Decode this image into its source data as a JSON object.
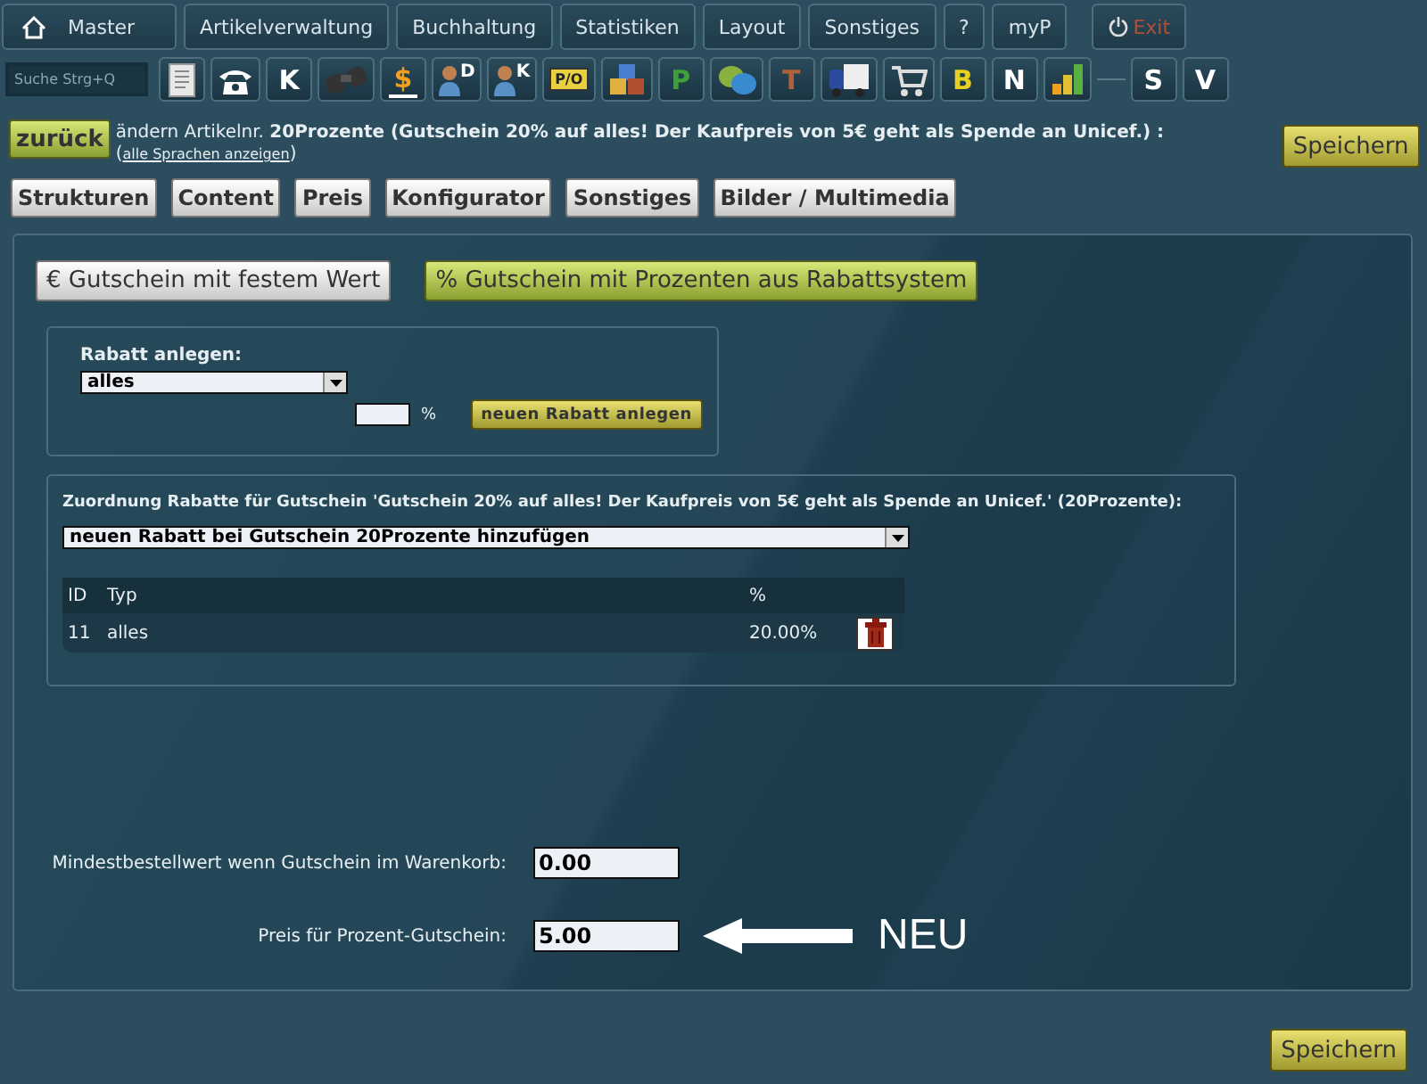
{
  "nav": [
    {
      "kind": "home",
      "label": "Master"
    },
    {
      "kind": "plain",
      "label": "Artikelverwaltung"
    },
    {
      "kind": "plain",
      "label": "Buchhaltung"
    },
    {
      "kind": "plain",
      "label": "Statistiken"
    },
    {
      "kind": "plain",
      "label": "Layout"
    },
    {
      "kind": "plain",
      "label": "Sonstiges"
    },
    {
      "kind": "plain",
      "label": "?"
    },
    {
      "kind": "plain",
      "label": "myP"
    },
    {
      "kind": "exit",
      "label": "Exit"
    }
  ],
  "search": {
    "placeholder": "Suche Strg+Q"
  },
  "toolbar": [
    {
      "kind": "document"
    },
    {
      "kind": "phone"
    },
    {
      "kind": "letter",
      "label": "K",
      "color": "#ffffff"
    },
    {
      "kind": "binoculars"
    },
    {
      "kind": "dollar",
      "label": "$"
    },
    {
      "kind": "person",
      "label": "D"
    },
    {
      "kind": "person",
      "label": "K"
    },
    {
      "kind": "sign",
      "label": "P/O"
    },
    {
      "kind": "cubes"
    },
    {
      "kind": "letter",
      "label": "P",
      "color": "#3fa03a"
    },
    {
      "kind": "chat"
    },
    {
      "kind": "letter",
      "label": "T",
      "color": "#b0603a"
    },
    {
      "kind": "truck"
    },
    {
      "kind": "cart"
    },
    {
      "kind": "letter",
      "label": "B",
      "color": "#e8d020"
    },
    {
      "kind": "letter",
      "label": "N",
      "color": "#ffffff"
    },
    {
      "kind": "chart"
    }
  ],
  "toolbar_right": [
    {
      "kind": "letter",
      "label": "S",
      "color": "#ffffff"
    },
    {
      "kind": "letter",
      "label": "V",
      "color": "#ffffff"
    }
  ],
  "back_button": "zurück",
  "heading": {
    "prefix": "ändern Artikelnr.",
    "text": "**20Prozente (Gutschein 20% auf alles! Der Kaufpreis von 5€ geht als Spende an Unicef.) :**",
    "link_open": "(",
    "link": "alle Sprachen anzeigen",
    "link_close": ")"
  },
  "save_top": "Speichern",
  "section_tabs": [
    "Strukturen",
    "Content",
    "Preis",
    "Konfigurator",
    "Sonstiges",
    "Bilder / Multimedia"
  ],
  "voucher_types": [
    {
      "label": "€ Gutschein mit festem Wert",
      "selected": false
    },
    {
      "label": "% Gutschein mit Prozenten aus Rabattsystem",
      "selected": true
    }
  ],
  "discount_create": {
    "label": "Rabatt anlegen:",
    "select": "alles",
    "percent_unit": "%",
    "button": "neuen Rabatt anlegen"
  },
  "assignment": {
    "title": "Zuordnung Rabatte für Gutschein 'Gutschein 20% auf alles! Der Kaufpreis von 5€ geht als Spende an Unicef.' (20Prozente):",
    "select": "neuen Rabatt bei Gutschein 20Prozente hinzufügen",
    "columns": [
      "ID",
      "Typ",
      "%"
    ],
    "rows": [
      [
        "11",
        "alles",
        "20.00%"
      ]
    ]
  },
  "fields": [
    {
      "label": "Mindestbestellwert wenn Gutschein im Warenkorb:",
      "value": "0.00"
    },
    {
      "label": "Preis für Prozent-Gutschein:",
      "value": "5.00",
      "note": "NEU"
    }
  ],
  "save_bottom": "Speichern"
}
